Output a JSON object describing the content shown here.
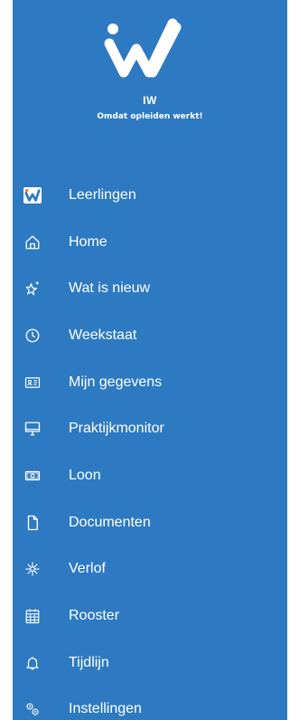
{
  "header": {
    "brand": "IW",
    "tagline": "Omdat opleiden werkt!"
  },
  "colors": {
    "drawer_bg": "#2e7ac2",
    "text": "#ffffff",
    "logo_orange": "#f08a24"
  },
  "menu": {
    "items": [
      {
        "label": "Leerlingen",
        "icon": "iw-logo-icon"
      },
      {
        "label": "Home",
        "icon": "home-icon"
      },
      {
        "label": "Wat is nieuw",
        "icon": "sparkle-star-icon"
      },
      {
        "label": "Weekstaat",
        "icon": "clock-icon"
      },
      {
        "label": "Mijn gegevens",
        "icon": "id-card-icon"
      },
      {
        "label": "Praktijkmonitor",
        "icon": "monitor-icon"
      },
      {
        "label": "Loon",
        "icon": "banknote-icon"
      },
      {
        "label": "Documenten",
        "icon": "document-icon"
      },
      {
        "label": "Verlof",
        "icon": "snowflake-sun-icon"
      },
      {
        "label": "Rooster",
        "icon": "calendar-icon"
      },
      {
        "label": "Tijdlijn",
        "icon": "bell-icon"
      },
      {
        "label": "Instellingen",
        "icon": "gears-icon"
      }
    ]
  }
}
